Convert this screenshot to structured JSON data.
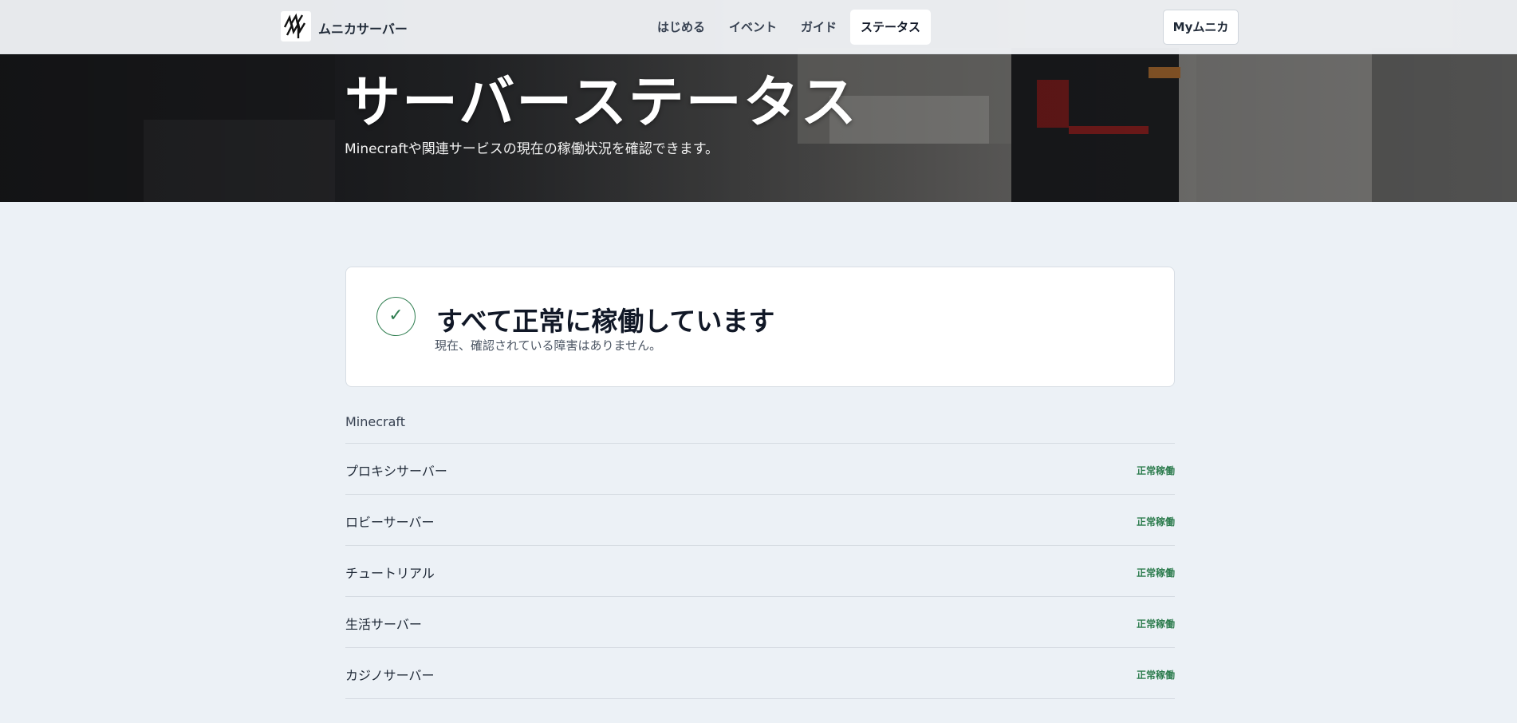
{
  "header": {
    "brand": "ムニカサーバー",
    "nav": [
      {
        "label": "はじめる",
        "active": false
      },
      {
        "label": "イベント",
        "active": false
      },
      {
        "label": "ガイド",
        "active": false
      },
      {
        "label": "ステータス",
        "active": true
      }
    ],
    "account_button": "Myムニカ",
    "logo_icon": "munika-logo-icon"
  },
  "hero": {
    "title": "サーバーステータス",
    "subtitle": "Minecraftや関連サービスの現在の稼働状況を確認できます。"
  },
  "status_card": {
    "icon": "check-icon",
    "title": "すべて正常に稼働しています",
    "description": "現在、確認されている障害はありません。"
  },
  "services": {
    "section_title": "Minecraft",
    "items": [
      {
        "name": "プロキシサーバー",
        "status": "正常稼働"
      },
      {
        "name": "ロビーサーバー",
        "status": "正常稼働"
      },
      {
        "name": "チュートリアル",
        "status": "正常稼働"
      },
      {
        "name": "生活サーバー",
        "status": "正常稼働"
      },
      {
        "name": "カジノサーバー",
        "status": "正常稼働"
      }
    ]
  },
  "colors": {
    "ok_green": "#2e7d4f",
    "page_bg": "#ecf1f6"
  }
}
